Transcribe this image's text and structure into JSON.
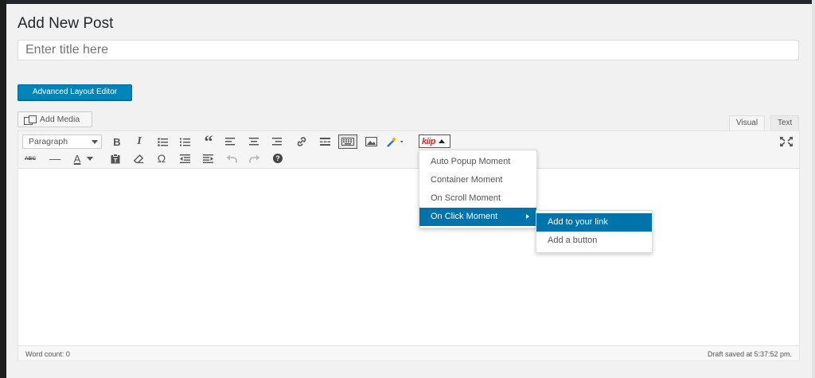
{
  "page": {
    "title": "Add New Post"
  },
  "title_field": {
    "placeholder": "Enter title here",
    "value": ""
  },
  "buttons": {
    "advanced_layout_editor": "Advanced Layout Editor",
    "add_media": "Add Media"
  },
  "editor_tabs": {
    "visual": "Visual",
    "text": "Text",
    "active": "Visual"
  },
  "toolbar": {
    "format_select": "Paragraph",
    "row1_icons": [
      "bold-icon",
      "italic-icon",
      "bullet-list-icon",
      "numbered-list-icon",
      "blockquote-icon",
      "align-left-icon",
      "align-center-icon",
      "align-right-icon",
      "link-icon",
      "read-more-icon",
      "toolbar-toggle-icon",
      "image-icon",
      "magic-wand-icon",
      "kiip-logo",
      "fullscreen-icon"
    ],
    "row2_icons": [
      "strikethrough-icon",
      "horizontal-line-icon",
      "text-color-icon",
      "paste-text-icon",
      "clear-formatting-icon",
      "special-character-icon",
      "outdent-icon",
      "indent-icon",
      "undo-icon",
      "redo-icon",
      "help-icon"
    ],
    "glyphs": {
      "bold": "B",
      "italic": "I",
      "blockquote": "“",
      "strike": "ABC",
      "hr": "—",
      "textcolor": "A",
      "omega": "Ω",
      "help": "?"
    },
    "kiip_label": "kiip"
  },
  "kiip_menu": {
    "items": [
      "Auto Popup Moment",
      "Container Moment",
      "On Scroll Moment",
      "On Click Moment"
    ],
    "active_item": "On Click Moment",
    "submenu": {
      "items": [
        "Add to your link",
        "Add a button"
      ],
      "active_item": "Add to your link"
    }
  },
  "status_bar": {
    "word_count": "Word count: 0",
    "draft_saved": "Draft saved at 5:37:52 pm."
  },
  "colors": {
    "primary": "#0085ba",
    "menu_highlight": "#0073aa",
    "kiip_red": "#e02424",
    "background": "#f1f1f1"
  }
}
